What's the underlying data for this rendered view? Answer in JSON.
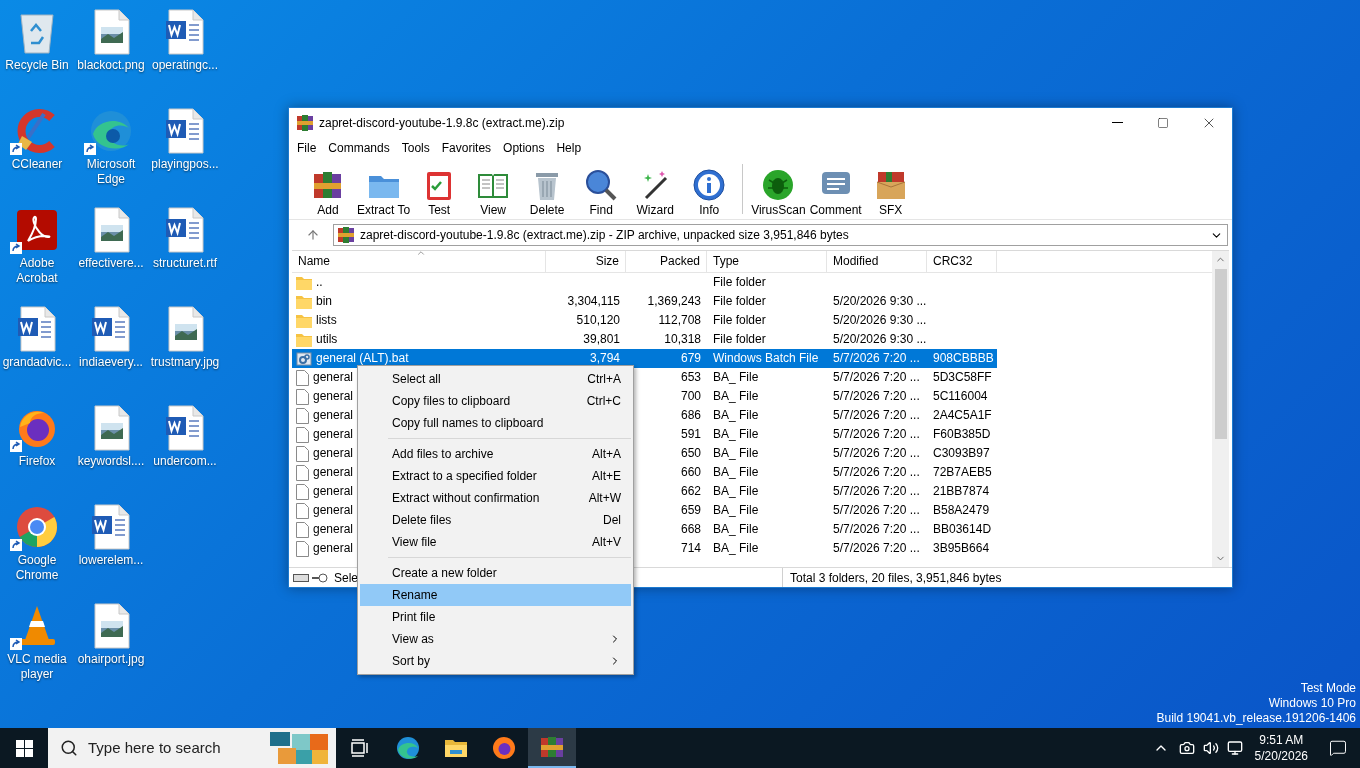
{
  "desktop_icons": [
    {
      "label": "Recycle Bin",
      "kind": "bin",
      "shortcut": false
    },
    {
      "label": "CCleaner",
      "kind": "app",
      "shortcut": true
    },
    {
      "label": "Adobe Acrobat",
      "kind": "app",
      "shortcut": true
    },
    {
      "label": "grandadvic...",
      "kind": "document",
      "shortcut": false
    },
    {
      "label": "Firefox",
      "kind": "app",
      "shortcut": true
    },
    {
      "label": "Google Chrome",
      "kind": "app",
      "shortcut": true
    },
    {
      "label": "VLC media player",
      "kind": "app",
      "shortcut": true
    },
    {
      "label": "blackoct.png",
      "kind": "image",
      "shortcut": false
    },
    {
      "label": "Microsoft Edge",
      "kind": "app",
      "shortcut": true
    },
    {
      "label": "effectivere...",
      "kind": "image",
      "shortcut": false
    },
    {
      "label": "indiaevery...",
      "kind": "document",
      "shortcut": false
    },
    {
      "label": "keywordsl....",
      "kind": "image",
      "shortcut": false
    },
    {
      "label": "lowerelem...",
      "kind": "document",
      "shortcut": false
    },
    {
      "label": "ohairport.jpg",
      "kind": "image",
      "shortcut": false
    },
    {
      "label": "operatingc...",
      "kind": "document",
      "shortcut": false
    },
    {
      "label": "playingpos...",
      "kind": "document",
      "shortcut": false
    },
    {
      "label": "structuret.rtf",
      "kind": "document",
      "shortcut": false
    },
    {
      "label": "trustmary.jpg",
      "kind": "image",
      "shortcut": false
    },
    {
      "label": "undercom...",
      "kind": "document",
      "shortcut": false
    }
  ],
  "window": {
    "title": "zapret-discord-youtube-1.9.8c (extract.me).zip",
    "menu": [
      "File",
      "Commands",
      "Tools",
      "Favorites",
      "Options",
      "Help"
    ],
    "toolbar": [
      {
        "label": "Add"
      },
      {
        "label": "Extract To"
      },
      {
        "label": "Test"
      },
      {
        "label": "View"
      },
      {
        "label": "Delete"
      },
      {
        "label": "Find"
      },
      {
        "label": "Wizard"
      },
      {
        "label": "Info"
      },
      {
        "label": "VirusScan"
      },
      {
        "label": "Comment"
      },
      {
        "label": "SFX"
      }
    ],
    "address": "zapret-discord-youtube-1.9.8c (extract.me).zip - ZIP archive, unpacked size 3,951,846 bytes",
    "list": {
      "columns": [
        "Name",
        "Size",
        "Packed",
        "Type",
        "Modified",
        "CRC32"
      ],
      "rows": [
        {
          "kind": "folder",
          "selected": false,
          "cells": [
            "..",
            "",
            "",
            "File folder",
            "",
            ""
          ]
        },
        {
          "kind": "folder",
          "selected": false,
          "cells": [
            "bin",
            "3,304,115",
            "1,369,243",
            "File folder",
            "5/20/2026 9:30 ...",
            ""
          ]
        },
        {
          "kind": "folder",
          "selected": false,
          "cells": [
            "lists",
            "510,120",
            "112,708",
            "File folder",
            "5/20/2026 9:30 ...",
            ""
          ]
        },
        {
          "kind": "folder",
          "selected": false,
          "cells": [
            "utils",
            "39,801",
            "10,318",
            "File folder",
            "5/20/2026 9:30 ...",
            ""
          ]
        },
        {
          "kind": "batch",
          "selected": true,
          "cells": [
            "general (ALT).bat",
            "3,794",
            "679",
            "Windows Batch File",
            "5/7/2026 7:20 ...",
            "908CBBBB"
          ]
        },
        {
          "kind": "file",
          "selected": false,
          "cells": [
            "general",
            "",
            "653",
            "BA_ File",
            "5/7/2026 7:20 ...",
            "5D3C58FF"
          ]
        },
        {
          "kind": "file",
          "selected": false,
          "cells": [
            "general",
            "",
            "700",
            "BA_ File",
            "5/7/2026 7:20 ...",
            "5C116004"
          ]
        },
        {
          "kind": "file",
          "selected": false,
          "cells": [
            "general",
            "",
            "686",
            "BA_ File",
            "5/7/2026 7:20 ...",
            "2A4C5A1F"
          ]
        },
        {
          "kind": "file",
          "selected": false,
          "cells": [
            "general",
            "",
            "591",
            "BA_ File",
            "5/7/2026 7:20 ...",
            "F60B385D"
          ]
        },
        {
          "kind": "file",
          "selected": false,
          "cells": [
            "general",
            "",
            "650",
            "BA_ File",
            "5/7/2026 7:20 ...",
            "C3093B97"
          ]
        },
        {
          "kind": "file",
          "selected": false,
          "cells": [
            "general",
            "",
            "660",
            "BA_ File",
            "5/7/2026 7:20 ...",
            "72B7AEB5"
          ]
        },
        {
          "kind": "file",
          "selected": false,
          "cells": [
            "general",
            "",
            "662",
            "BA_ File",
            "5/7/2026 7:20 ...",
            "21BB7874"
          ]
        },
        {
          "kind": "file",
          "selected": false,
          "cells": [
            "general",
            "",
            "659",
            "BA_ File",
            "5/7/2026 7:20 ...",
            "B58A2479"
          ]
        },
        {
          "kind": "file",
          "selected": false,
          "cells": [
            "general",
            "",
            "668",
            "BA_ File",
            "5/7/2026 7:20 ...",
            "BB03614D"
          ]
        },
        {
          "kind": "file",
          "selected": false,
          "cells": [
            "general",
            "",
            "714",
            "BA_ File",
            "5/7/2026 7:20 ...",
            "3B95B664"
          ]
        }
      ]
    },
    "status_bar": {
      "left": "Sele",
      "right": "Total 3 folders, 20 files, 3,951,846 bytes"
    }
  },
  "context_menu": [
    {
      "kind": "item",
      "label": "Select all",
      "shortcut": "Ctrl+A",
      "selected": false
    },
    {
      "kind": "item",
      "label": "Copy files to clipboard",
      "shortcut": "Ctrl+C",
      "selected": false
    },
    {
      "kind": "item",
      "label": "Copy full names to clipboard",
      "selected": false
    },
    {
      "kind": "separator"
    },
    {
      "kind": "item",
      "label": "Add files to archive",
      "shortcut": "Alt+A",
      "selected": false
    },
    {
      "kind": "item",
      "label": "Extract to a specified folder",
      "shortcut": "Alt+E",
      "selected": false
    },
    {
      "kind": "item",
      "label": "Extract without confirmation",
      "shortcut": "Alt+W",
      "selected": false
    },
    {
      "kind": "item",
      "label": "Delete files",
      "shortcut": "Del",
      "selected": false
    },
    {
      "kind": "item",
      "label": "View file",
      "shortcut": "Alt+V",
      "selected": false
    },
    {
      "kind": "separator"
    },
    {
      "kind": "item",
      "label": "Create a new folder",
      "selected": false
    },
    {
      "kind": "item",
      "label": "Rename",
      "selected": true
    },
    {
      "kind": "item",
      "label": "Print file",
      "selected": false
    },
    {
      "kind": "submenu",
      "label": "View as",
      "selected": false
    },
    {
      "kind": "submenu",
      "label": "Sort by",
      "selected": false
    }
  ],
  "system_notice": [
    "Test Mode",
    "Windows 10 Pro",
    "Build 19041.vb_release.191206-1406"
  ],
  "taskbar": {
    "search_placeholder": "Type here to search",
    "apps": [
      {
        "selected": false
      },
      {
        "selected": false
      },
      {
        "selected": false
      },
      {
        "selected": false
      },
      {
        "selected": true
      }
    ],
    "time": "9:51 AM",
    "date": "5/20/2026"
  }
}
